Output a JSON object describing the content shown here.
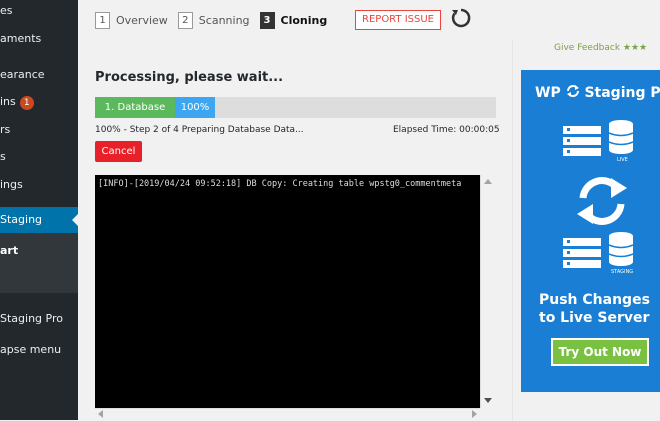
{
  "sidebar": {
    "items": [
      {
        "label": "es"
      },
      {
        "label": "aments"
      },
      {
        "label": "earance"
      },
      {
        "label": "ins",
        "badge": "1"
      },
      {
        "label": "rs"
      },
      {
        "label": "s"
      },
      {
        "label": "ings"
      },
      {
        "label": "Staging"
      },
      {
        "label": "art"
      },
      {
        "label": "Staging Pro"
      },
      {
        "label": "apse menu"
      }
    ]
  },
  "steps": [
    {
      "num": "1",
      "label": "Overview"
    },
    {
      "num": "2",
      "label": "Scanning"
    },
    {
      "num": "3",
      "label": "Cloning"
    }
  ],
  "report_label": "REPORT ISSUE",
  "feedback_label": "Give Feedback ★★★",
  "processing_title": "Processing, please wait...",
  "progress": {
    "step_label": "1. Database",
    "percent_label": "100%",
    "status_text": "100% - Step 2 of 4 Preparing Database Data...",
    "elapsed_text": "Elapsed Time: 00:00:05"
  },
  "cancel_label": "Cancel",
  "log": {
    "lines": [
      "[INFO]-[2019/04/24 09:52:18] DB Copy: Creating table wpstg0_commentmeta"
    ]
  },
  "ad": {
    "logo_text": "WP",
    "logo_text2": "Staging Pro",
    "live_tag": "LIVE",
    "staging_tag": "STAGING",
    "headline1": "Push Changes",
    "headline2": "to Live Server",
    "button_label": "Try Out Now"
  },
  "colors": {
    "sidebar_bg": "#23282d",
    "active_blue": "#0073aa",
    "progress_green": "#5cb85c",
    "progress_blue": "#3ea6f0",
    "cancel_red": "#e8202a",
    "ad_blue": "#1a7fd4",
    "ad_button_green": "#7ac142"
  }
}
